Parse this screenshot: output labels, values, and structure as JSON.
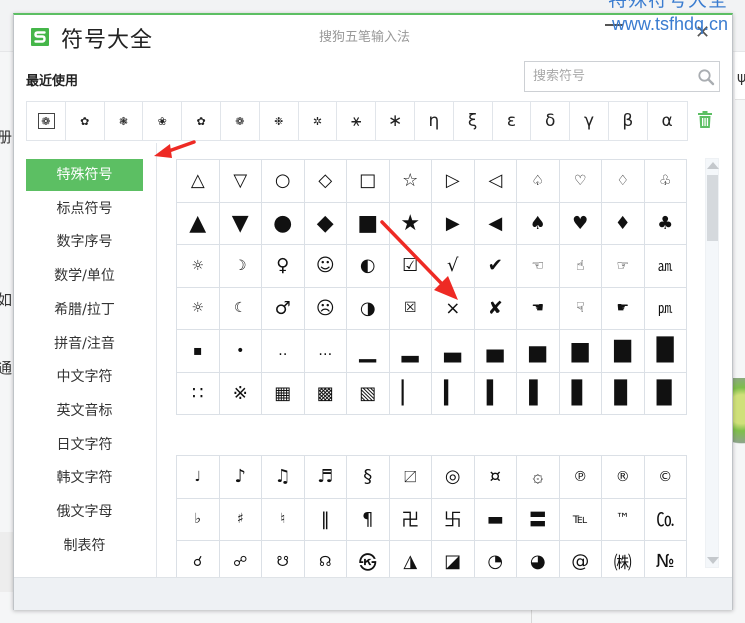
{
  "window": {
    "title": "符号大全",
    "subtitle": "搜狗五笔输入法",
    "minimize_icon": "minimize-icon",
    "close_icon": "close-icon",
    "close_glyph": "✕",
    "brand_color": "#5cbf63"
  },
  "watermark": {
    "line1": "特殊符号大全",
    "line2": "www.tsfhdq.cn",
    "color": "#3a7cd0"
  },
  "background": {
    "left_fragments": [
      "册",
      "如",
      "通"
    ],
    "right_icon_glyph": "ψ"
  },
  "recent": {
    "label": "最近使用",
    "symbols": [
      "❁",
      "✿",
      "❃",
      "❀",
      "✿",
      "❁",
      "❉",
      "✲",
      "⚹",
      "∗",
      "η",
      "ξ",
      "ε",
      "δ",
      "γ",
      "β",
      "α"
    ],
    "clear_icon": "trash-icon"
  },
  "search": {
    "placeholder": "搜索符号",
    "value": "",
    "icon": "search-icon"
  },
  "sidebar": {
    "items": [
      {
        "label": "特殊符号",
        "active": true
      },
      {
        "label": "标点符号",
        "active": false
      },
      {
        "label": "数字序号",
        "active": false
      },
      {
        "label": "数学/单位",
        "active": false
      },
      {
        "label": "希腊/拉丁",
        "active": false
      },
      {
        "label": "拼音/注音",
        "active": false
      },
      {
        "label": "中文字符",
        "active": false
      },
      {
        "label": "英文音标",
        "active": false
      },
      {
        "label": "日文字符",
        "active": false
      },
      {
        "label": "韩文字符",
        "active": false
      },
      {
        "label": "俄文字母",
        "active": false
      },
      {
        "label": "制表符",
        "active": false
      }
    ]
  },
  "symbol_groups": [
    {
      "rows": [
        [
          "△",
          "▽",
          "○",
          "◇",
          "□",
          "☆",
          "▷",
          "◁",
          "♤",
          "♡",
          "♢",
          "♧"
        ],
        [
          "▲",
          "▼",
          "●",
          "◆",
          "■",
          "★",
          "▶",
          "◀",
          "♠",
          "♥",
          "♦",
          "♣"
        ],
        [
          "☼",
          "☽",
          "♀",
          "☺",
          "◐",
          "☑",
          "√",
          "✔",
          "☜",
          "☝",
          "☞",
          "㏂"
        ],
        [
          "☼",
          "☾",
          "♂",
          "☹",
          "◑",
          "☒",
          "×",
          "✘",
          "☚",
          "☟",
          "☛",
          "㏘"
        ],
        [
          "▪",
          "•",
          "‥",
          "…",
          "▁",
          "▂",
          "▃",
          "▄",
          "▅",
          "▆",
          "▇",
          "█"
        ],
        [
          "∷",
          "※",
          "▦",
          "▩",
          "▧",
          "▏",
          "▎",
          "▍",
          "▌",
          "▋",
          "▊",
          "▉"
        ]
      ]
    },
    {
      "rows": [
        [
          "♩",
          "♪",
          "♫",
          "♬",
          "§",
          "〼",
          "◎",
          "¤",
          "۞",
          "℗",
          "®",
          "©"
        ],
        [
          "♭",
          "♯",
          "♮",
          "‖",
          "¶",
          "卍",
          "卐",
          "▬",
          "〓",
          "℡",
          "™",
          "㏇"
        ],
        [
          "☌",
          "☍",
          "☋",
          "☊",
          "㉿",
          "◮",
          "◪",
          "◔",
          "◕",
          "@",
          "㈱",
          "№"
        ]
      ]
    }
  ],
  "scrollbar": {
    "position": 0.0,
    "visible_fraction": 0.17
  }
}
